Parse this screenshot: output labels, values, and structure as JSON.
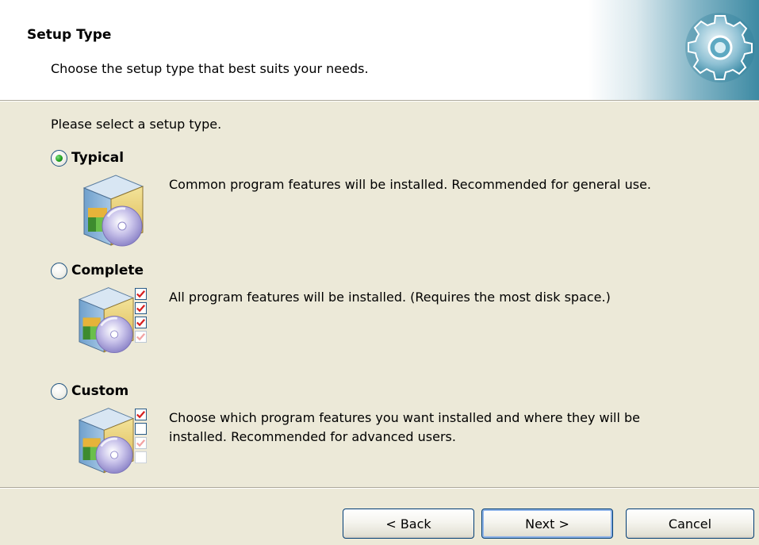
{
  "header": {
    "title": "Setup Type",
    "subtitle": "Choose the setup type that best suits your needs."
  },
  "prompt": "Please select a setup type.",
  "options": [
    {
      "label": "Typical",
      "selected": true,
      "description": "Common program features will be installed. Recommended for general use.",
      "icon": "package-disc-icon"
    },
    {
      "label": "Complete",
      "selected": false,
      "description": "All program features will be installed. (Requires the most disk space.)",
      "icon": "package-disc-all-checked-icon"
    },
    {
      "label": "Custom",
      "selected": false,
      "description": "Choose which program features you want installed and where they will be installed. Recommended for advanced users.",
      "icon": "package-disc-partial-checked-icon"
    }
  ],
  "buttons": {
    "back": "< Back",
    "next": "Next >",
    "cancel": "Cancel"
  },
  "colors": {
    "dialog_bg": "#ece9d8",
    "header_bg": "#ffffff",
    "accent": "#3d8aa3",
    "radio_dot": "#21a121"
  }
}
